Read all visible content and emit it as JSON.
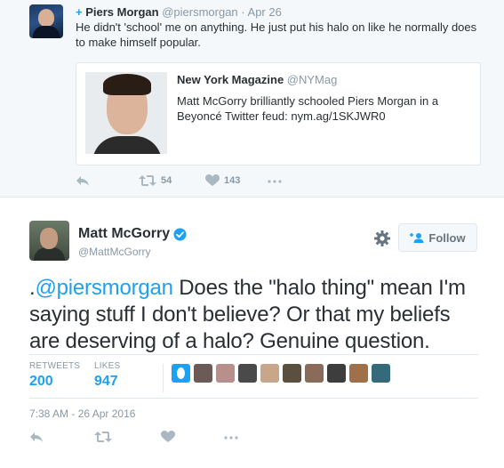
{
  "retweet_context": {
    "plus_symbol": "+",
    "author_name": "Piers Morgan",
    "author_handle": "@piersmorgan",
    "separator": "·",
    "date": "Apr 26",
    "text": "He didn't 'school' me on anything. He just put his halo on like he normally does to make himself popular.",
    "quoted": {
      "author_name": "New York Magazine",
      "author_handle": "@NYMag",
      "text": "Matt McGorry brilliantly schooled Piers Morgan in a Beyoncé Twitter feud: nym.ag/1SKJWR0"
    },
    "actions": {
      "reply_icon": "reply-icon",
      "retweet_icon": "retweet-icon",
      "retweet_count": "54",
      "like_icon": "heart-icon",
      "like_count": "143",
      "more_icon": "more-icon"
    }
  },
  "main_tweet": {
    "author_name": "Matt McGorry",
    "author_handle": "@MattMcGorry",
    "verified_icon": "verified-badge-icon",
    "follow_label": "Follow",
    "text_prefix": ".",
    "mention": "@piersmorgan",
    "text_body": " Does the \"halo thing\" mean I'm saying stuff I don't believe? Or that my beliefs are deserving of a halo? Genuine question.",
    "stats": {
      "retweets_label": "RETWEETS",
      "retweets_value": "200",
      "likes_label": "LIKES",
      "likes_value": "947"
    },
    "liker_colors": [
      "#1da1f2",
      "#6b5a55",
      "#b88f8a",
      "#4a4a4a",
      "#c9a58a",
      "#5b5040",
      "#8a6b5a",
      "#3d3d3d",
      "#a0704a",
      "#356a7a"
    ],
    "timestamp": "7:38 AM - 26 Apr 2016"
  },
  "colors": {
    "accent": "#1da1f2",
    "muted": "#8899a6",
    "text": "#292f33"
  }
}
